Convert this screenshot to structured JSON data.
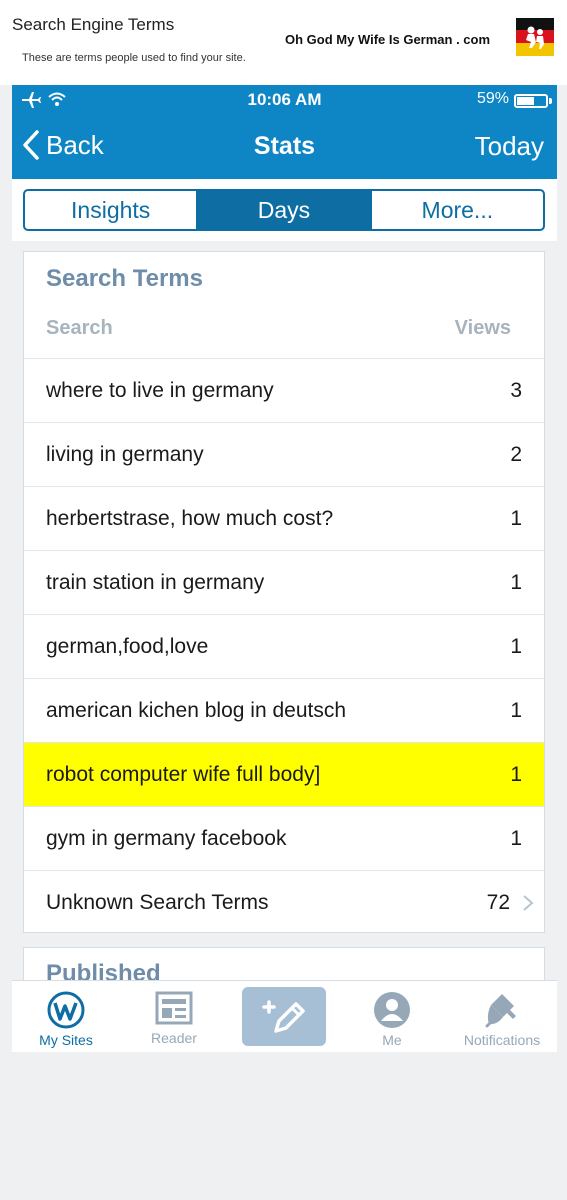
{
  "page": {
    "title": "Search Engine Terms",
    "subtitle": "These are terms people used to find your site.",
    "brand": "Oh God My Wife Is German . com"
  },
  "status_bar": {
    "time": "10:06 AM",
    "battery_text": "59%",
    "battery_level": 0.59
  },
  "nav": {
    "back_label": "Back",
    "title": "Stats",
    "right_label": "Today"
  },
  "segments": {
    "items": [
      "Insights",
      "Days",
      "More..."
    ],
    "selected": "Days"
  },
  "search_terms": {
    "title": "Search Terms",
    "col_search": "Search",
    "col_views": "Views",
    "rows": [
      {
        "term": "where to live in germany",
        "views": "3"
      },
      {
        "term": "living in germany",
        "views": "2"
      },
      {
        "term": "herbertstrase, how much cost?",
        "views": "1"
      },
      {
        "term": "train station in germany",
        "views": "1"
      },
      {
        "term": "german,food,love",
        "views": "1"
      },
      {
        "term": "american kichen blog in deutsch",
        "views": "1"
      },
      {
        "term": "robot computer wife full body]",
        "views": "1"
      },
      {
        "term": "gym in germany facebook",
        "views": "1"
      },
      {
        "term": "Unknown Search Terms",
        "views": "72"
      }
    ],
    "highlight_color": "#ffff00"
  },
  "next_section": {
    "title": "Published"
  },
  "tabbar": {
    "my_sites": "My Sites",
    "reader": "Reader",
    "me": "Me",
    "notifications": "Notifications"
  },
  "colors": {
    "brand_blue": "#0e86c5",
    "segment_blue": "#0e6ea3",
    "section_title": "#6f8da8"
  },
  "icons": [
    "airplane-mode-icon",
    "wifi-icon",
    "battery-icon",
    "chevron-left-icon",
    "chevron-right-icon",
    "wordpress-icon",
    "reader-icon",
    "write-post-icon",
    "me-icon",
    "notifications-bell-icon",
    "german-flag-logo"
  ]
}
